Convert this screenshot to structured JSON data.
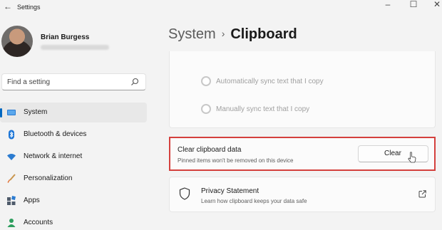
{
  "window": {
    "title": "Settings",
    "back_glyph": "←",
    "minimize_glyph": "–",
    "maximize_glyph": "☐",
    "close_glyph": "✕"
  },
  "user": {
    "name": "Brian Burgess"
  },
  "search": {
    "placeholder": "Find a setting"
  },
  "nav": {
    "items": [
      {
        "label": "System",
        "icon": "monitor-icon",
        "active": true
      },
      {
        "label": "Bluetooth & devices",
        "icon": "bluetooth-icon"
      },
      {
        "label": "Network & internet",
        "icon": "wifi-icon"
      },
      {
        "label": "Personalization",
        "icon": "brush-icon"
      },
      {
        "label": "Apps",
        "icon": "apps-icon"
      },
      {
        "label": "Accounts",
        "icon": "person-icon"
      }
    ]
  },
  "header": {
    "parent": "System",
    "separator": "›",
    "current": "Clipboard"
  },
  "sync": {
    "option_auto": "Automatically sync text that I copy",
    "option_manual": "Manually sync text that I copy"
  },
  "clear_data": {
    "title": "Clear clipboard data",
    "subtitle": "Pinned items won't be removed on this device",
    "button_label": "Clear",
    "highlight_color": "#d4403d"
  },
  "privacy": {
    "title": "Privacy Statement",
    "subtitle": "Learn how clipboard keeps your data safe"
  },
  "colors": {
    "accent": "#0067c0",
    "background": "#f3f3f3",
    "card": "#fbfbfb"
  }
}
